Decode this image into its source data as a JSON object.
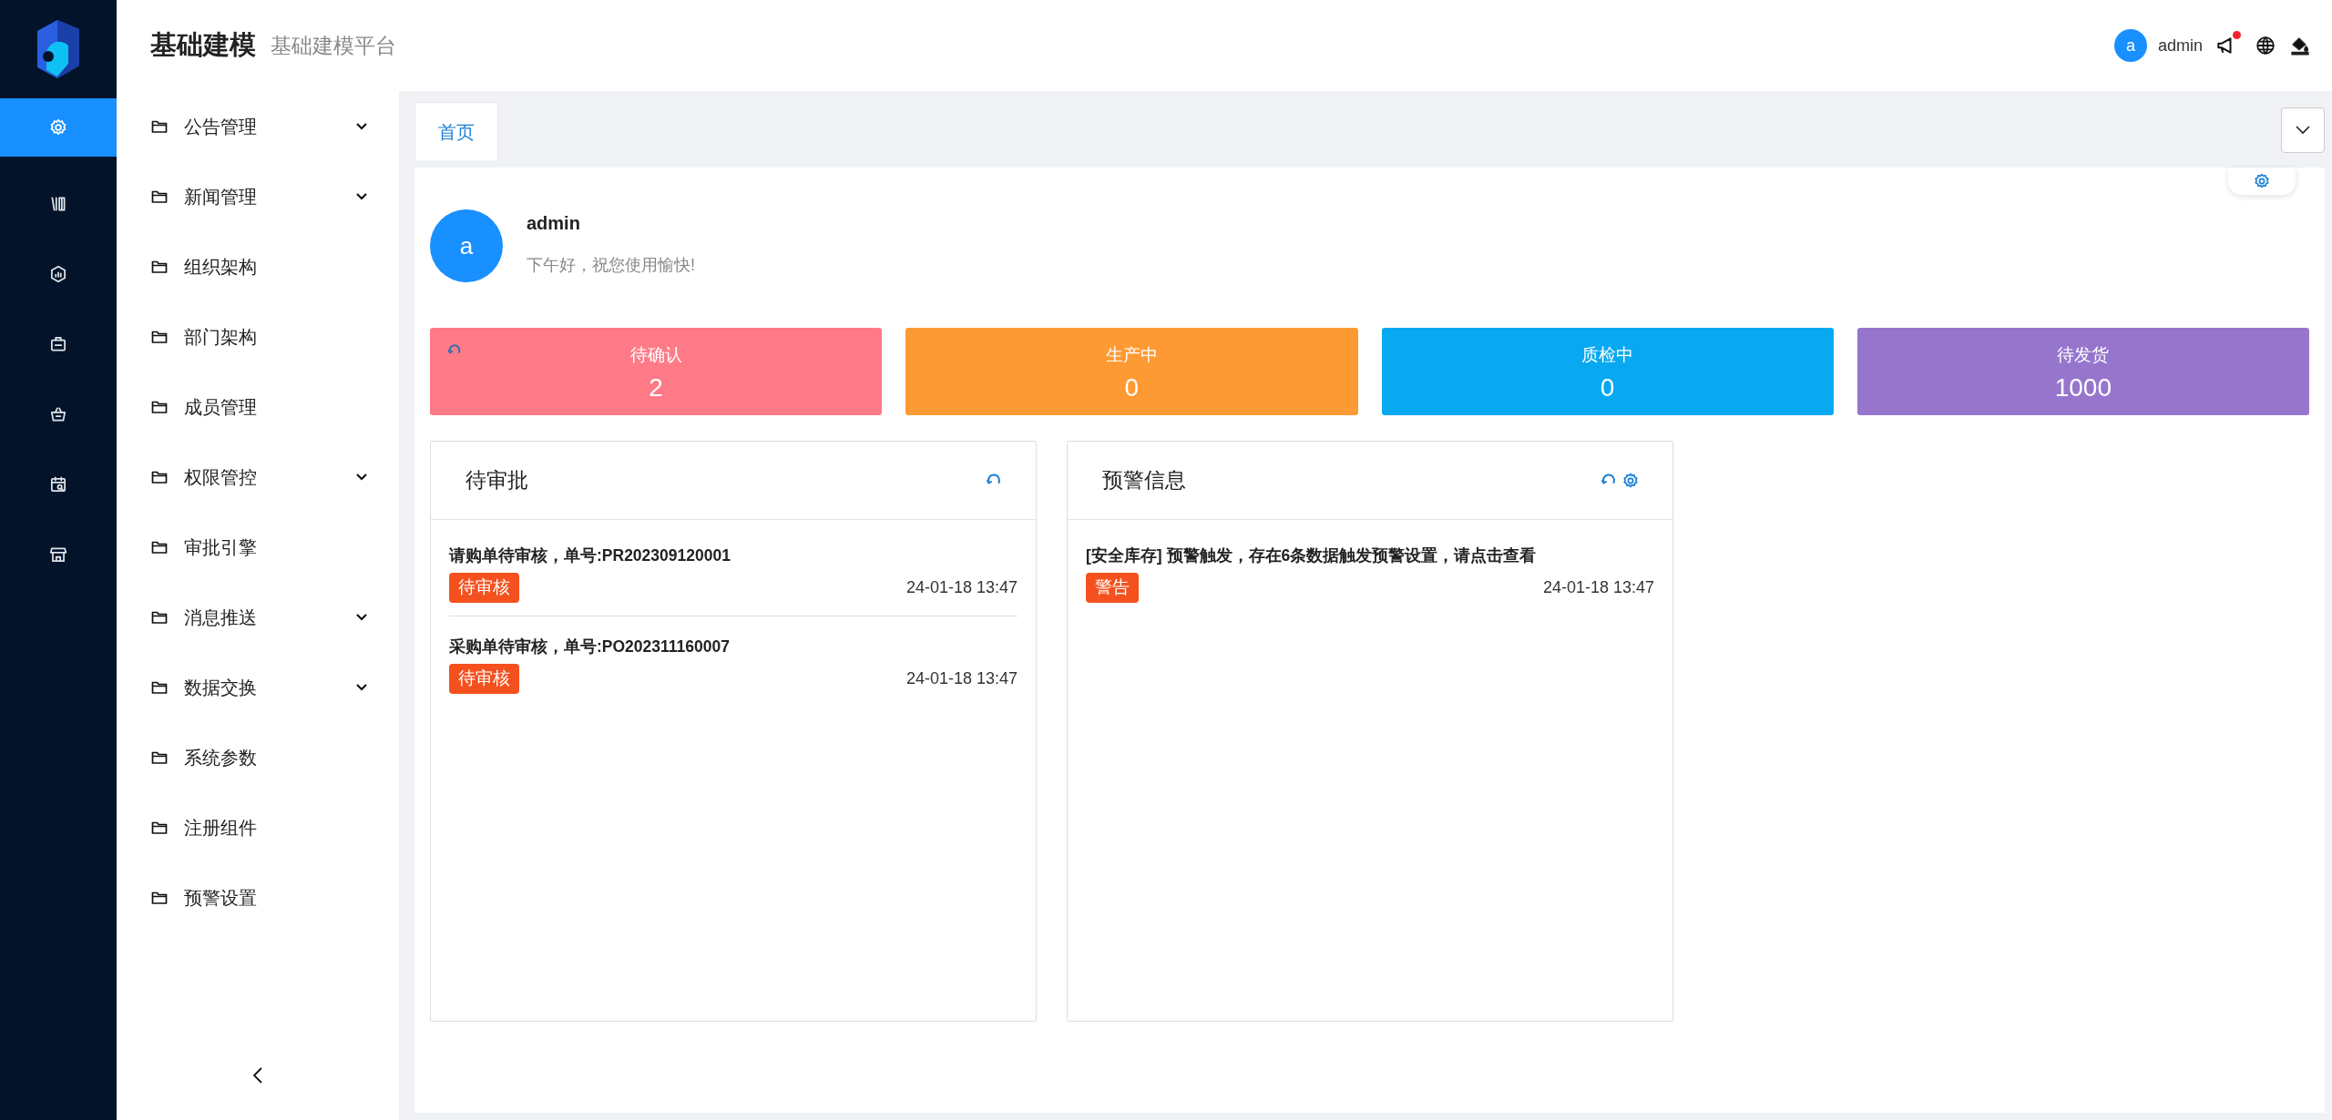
{
  "header": {
    "title": "基础建模",
    "subtitle": "基础建模平台",
    "user": {
      "avatar_letter": "a",
      "name": "admin"
    },
    "has_unread": true
  },
  "rail": [
    {
      "kind": "gear",
      "selected": true
    },
    {
      "kind": "books",
      "selected": false
    },
    {
      "kind": "chart",
      "selected": false
    },
    {
      "kind": "briefcase",
      "selected": false
    },
    {
      "kind": "basket",
      "selected": false
    },
    {
      "kind": "calendar",
      "selected": false
    },
    {
      "kind": "store",
      "selected": false
    }
  ],
  "menu": [
    {
      "label": "公告管理",
      "has_children": true
    },
    {
      "label": "新闻管理",
      "has_children": true
    },
    {
      "label": "组织架构",
      "has_children": false
    },
    {
      "label": "部门架构",
      "has_children": false
    },
    {
      "label": "成员管理",
      "has_children": false
    },
    {
      "label": "权限管控",
      "has_children": true
    },
    {
      "label": "审批引擎",
      "has_children": false
    },
    {
      "label": "消息推送",
      "has_children": true
    },
    {
      "label": "数据交换",
      "has_children": true
    },
    {
      "label": "系统参数",
      "has_children": false
    },
    {
      "label": "注册组件",
      "has_children": false
    },
    {
      "label": "预警设置",
      "has_children": false
    }
  ],
  "tabs": [
    {
      "label": "首页",
      "selected": true
    }
  ],
  "profile": {
    "avatar_letter": "a",
    "name": "admin",
    "greeting": "下午好，祝您使用愉快!"
  },
  "stats": [
    {
      "label": "待确认",
      "value": "2",
      "color": "#fe7a87",
      "loading": true
    },
    {
      "label": "生产中",
      "value": "0",
      "color": "#fe9a33",
      "loading": false
    },
    {
      "label": "质检中",
      "value": "0",
      "color": "#08a9f1",
      "loading": false
    },
    {
      "label": "待发货",
      "value": "1000",
      "color": "#9676cd",
      "loading": false
    }
  ],
  "panels": [
    {
      "title": "待审批",
      "has_settings": false,
      "items": [
        {
          "text": "请购单待审核，单号:PR202309120001",
          "tag": "待审核",
          "date": "24-01-18 13:47"
        },
        {
          "text": "采购单待审核，单号:PO202311160007",
          "tag": "待审核",
          "date": "24-01-18 13:47"
        }
      ]
    },
    {
      "title": "预警信息",
      "has_settings": true,
      "items": [
        {
          "text": "[安全库存] 预警触发，存在6条数据触发预警设置，请点击查看",
          "tag": "警告",
          "date": "24-01-18 13:47"
        }
      ]
    }
  ]
}
